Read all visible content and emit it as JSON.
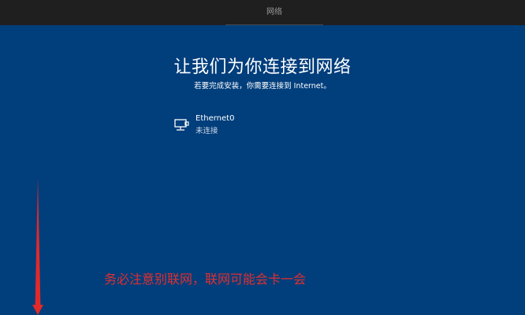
{
  "topbar": {
    "tab_label": "网络"
  },
  "main": {
    "title": "让我们为你连接到网络",
    "subtitle": "若要完成安装，你需要连接到 Internet。",
    "networks": [
      {
        "name": "Ethernet0",
        "status": "未连接",
        "icon": "ethernet-icon"
      }
    ]
  },
  "annotation": {
    "text": "务必注意别联网，联网可能会卡一会",
    "color": "#e03030"
  },
  "colors": {
    "background": "#003e7c",
    "topbar": "#1f1f1f",
    "text": "#ffffff"
  }
}
